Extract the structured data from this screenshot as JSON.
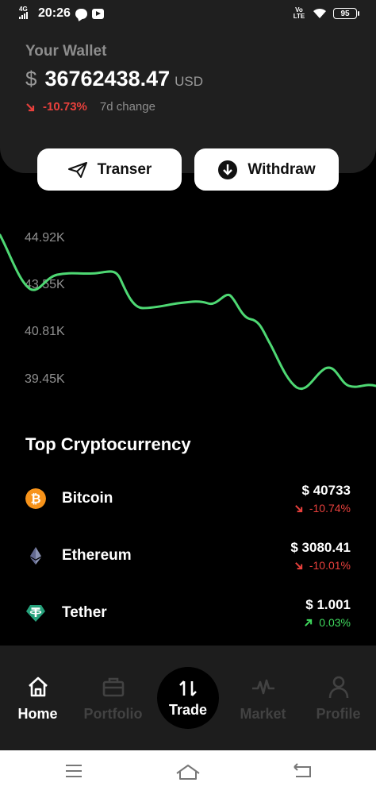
{
  "status_bar": {
    "network": "4G",
    "time": "20:26",
    "volte": "Vo LTE",
    "battery": "95"
  },
  "wallet": {
    "label": "Your Wallet",
    "currency_symbol": "$",
    "amount": "36762438.47",
    "unit": "USD",
    "change": "-10.73%",
    "change_label": "7d change"
  },
  "actions": {
    "transfer_label": "Transer",
    "withdraw_label": "Withdraw"
  },
  "chart": {
    "ticks": [
      "44.92K",
      "43.55K",
      "40.81K",
      "39.45K"
    ],
    "line_color": "#4ed873"
  },
  "top_crypto": {
    "title": "Top Cryptocurrency",
    "coins": [
      {
        "name": "Bitcoin",
        "price": "$ 40733",
        "change": "-10.74%",
        "direction": "down",
        "icon": "bitcoin-icon",
        "color": "#f7931a"
      },
      {
        "name": "Ethereum",
        "price": "$ 3080.41",
        "change": "-10.01%",
        "direction": "down",
        "icon": "ethereum-icon",
        "color": "#8a92b2"
      },
      {
        "name": "Tether",
        "price": "$ 1.001",
        "change": "0.03%",
        "direction": "up",
        "icon": "tether-icon",
        "color": "#26a17b"
      }
    ]
  },
  "bottom_nav": {
    "home": "Home",
    "portfolio": "Portfolio",
    "trade": "Trade",
    "market": "Market",
    "profile": "Profile",
    "active": "Home"
  },
  "colors": {
    "negative": "#e8403c",
    "positive": "#3fd95d",
    "card": "#1f1f1f"
  }
}
